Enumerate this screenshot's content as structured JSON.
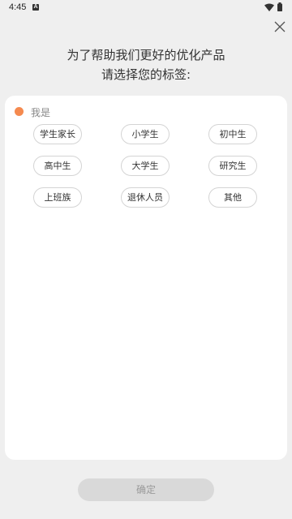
{
  "status_bar": {
    "time": "4:45",
    "notification_icon": "a-icon",
    "wifi_icon": "wifi-icon",
    "battery_icon": "battery-icon"
  },
  "close_icon": "close-icon",
  "heading": {
    "line1": "为了帮助我们更好的优化产品",
    "line2": "请选择您的标签:"
  },
  "section": {
    "label": "我是",
    "dot_color": "#f58a4f"
  },
  "tags": [
    "学生家长",
    "小学生",
    "初中生",
    "高中生",
    "大学生",
    "研究生",
    "上班族",
    "退休人员",
    "其他"
  ],
  "confirm_label": "确定"
}
